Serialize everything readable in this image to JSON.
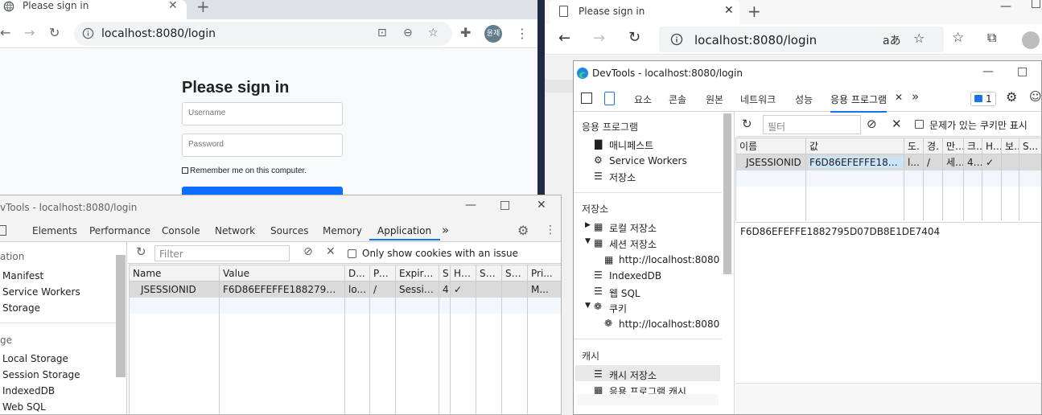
{
  "left_browser": {
    "tab_title": "Please sign in",
    "url": "localhost:8080/login",
    "avatar": "윤제",
    "page": {
      "heading": "Please sign in",
      "username_placeholder": "Username",
      "password_placeholder": "Password",
      "remember_label": "Remember me on this computer."
    }
  },
  "left_devtools": {
    "title": "vTools - localhost:8080/login",
    "tabs": [
      "Elements",
      "Performance",
      "Console",
      "Network",
      "Sources",
      "Memory",
      "Application"
    ],
    "active_tab": "Application",
    "more": "»",
    "sidebar": {
      "section1_head": "ation",
      "items1": [
        "Manifest",
        "Service Workers",
        "Storage"
      ],
      "section2_head": "ge",
      "items2": [
        "Local Storage",
        "Session Storage",
        "IndexedDB",
        "Web SQL"
      ]
    },
    "filter_placeholder": "Filter",
    "only_issue_label": "Only show cookies with an issue",
    "columns": [
      "Name",
      "Value",
      "D...",
      "Pa...",
      "Expire...",
      "S.",
      "Ht...",
      "Se...",
      "Sa...",
      "Pri..."
    ],
    "row": [
      "JSESSIONID",
      "F6D86EFEFFE1882795D07...",
      "lo...",
      "/",
      "Session",
      "4.",
      "✓",
      "",
      "",
      "M..."
    ]
  },
  "right_browser": {
    "tab_title": "Please sign in",
    "url": "localhost:8080/login"
  },
  "right_devtools": {
    "title": "DevTools - localhost:8080/login",
    "tabs": [
      "요소",
      "콘솔",
      "원본",
      "네트워크",
      "성능",
      "응용 프로그램"
    ],
    "active_tab": "응용 프로그램",
    "more": "»",
    "issues_badge": "1",
    "sidebar": {
      "section1_head": "응용 프로그램",
      "items1": [
        "매니페스트",
        "Service Workers",
        "저장소"
      ],
      "section2_head": "저장소",
      "local_storage": "로컬 저장소",
      "session_storage": "세션 저장소",
      "session_origin": "http://localhost:8080",
      "indexeddb": "IndexedDB",
      "websql": "웹 SQL",
      "cookies": "쿠키",
      "cookie_origin": "http://localhost:8080",
      "section3_head": "캐시",
      "cache_storage": "캐시 저장소",
      "app_cache": "응용 프로그램 캐시"
    },
    "filter_placeholder": "필터",
    "only_issue_label": "문제가 있는 쿠키만 표시",
    "columns": [
      "이름",
      "값",
      "도.",
      "경.",
      "만..",
      "크.",
      "H...",
      "보.",
      "S..."
    ],
    "row": [
      "JSESSIONID",
      "F6D86EFEFFE18827...",
      "l...",
      "/",
      "세...",
      "42",
      "✓",
      "",
      ""
    ],
    "full_value": "F6D86EFEFFE1882795D07DB8E1DE7404"
  }
}
